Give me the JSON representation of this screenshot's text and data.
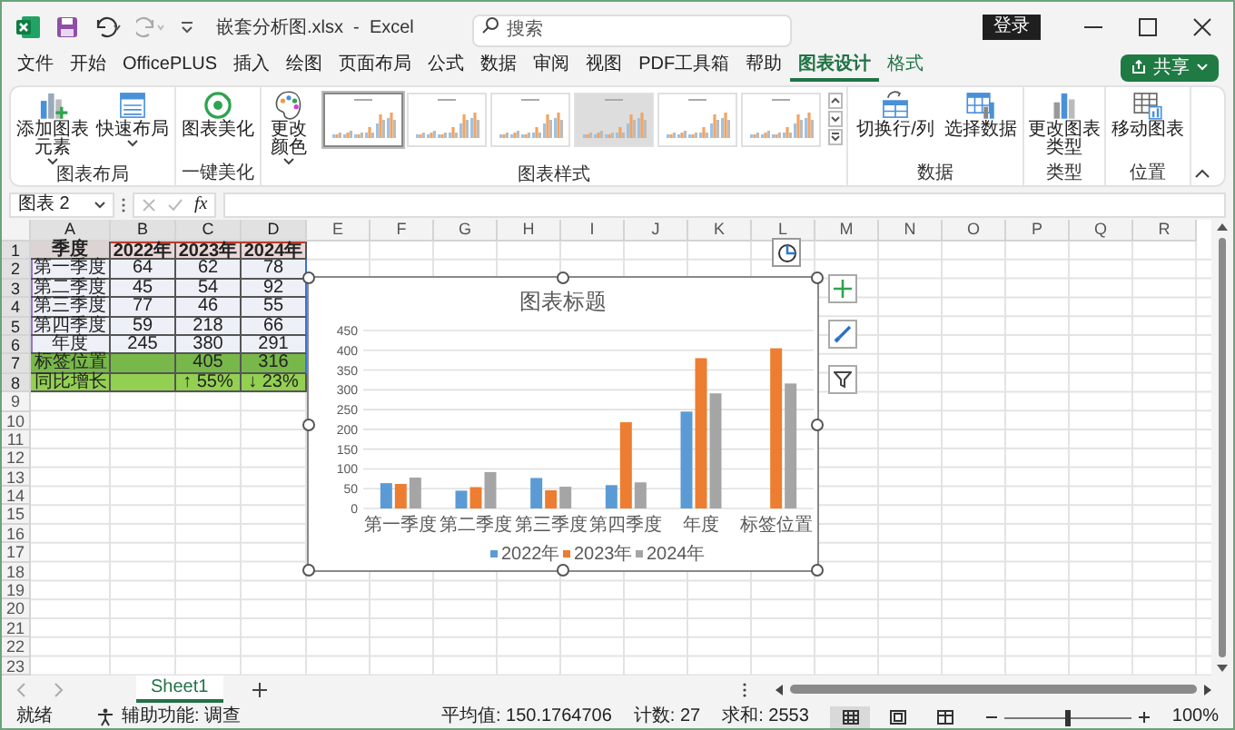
{
  "title_bar": {
    "file_title": "嵌套分析图.xlsx  -  Excel",
    "search": {
      "placeholder": "搜索"
    },
    "sign_in_button": "登录"
  },
  "menu_tabs": [
    {
      "label": "文件",
      "selected": false,
      "contextual": false
    },
    {
      "label": "开始",
      "selected": false,
      "contextual": false
    },
    {
      "label": "OfficePLUS",
      "selected": false,
      "contextual": false
    },
    {
      "label": "插入",
      "selected": false,
      "contextual": false
    },
    {
      "label": "绘图",
      "selected": false,
      "contextual": false
    },
    {
      "label": "页面布局",
      "selected": false,
      "contextual": false
    },
    {
      "label": "公式",
      "selected": false,
      "contextual": false
    },
    {
      "label": "数据",
      "selected": false,
      "contextual": false
    },
    {
      "label": "审阅",
      "selected": false,
      "contextual": false
    },
    {
      "label": "视图",
      "selected": false,
      "contextual": false
    },
    {
      "label": "PDF工具箱",
      "selected": false,
      "contextual": false
    },
    {
      "label": "帮助",
      "selected": false,
      "contextual": false
    },
    {
      "label": "图表设计",
      "selected": true,
      "contextual": true
    },
    {
      "label": "格式",
      "selected": false,
      "contextual": true
    }
  ],
  "share_button": {
    "label": "共享"
  },
  "ribbon": {
    "groups": [
      {
        "label": "图表布局",
        "buttons": [
          {
            "label": "添加图表元素",
            "dropdown": true
          },
          {
            "label": "快速布局",
            "dropdown": true
          }
        ]
      },
      {
        "label": "一键美化",
        "buttons": [
          {
            "label": "图表美化",
            "dropdown": false
          }
        ]
      },
      {
        "label": "图表样式",
        "buttons": [
          {
            "label": "更改颜色",
            "dropdown": true
          }
        ],
        "gallery": [
          {
            "selected": true
          },
          {
            "selected": false
          },
          {
            "selected": false
          },
          {
            "selected": false
          },
          {
            "selected": false
          },
          {
            "selected": false
          }
        ]
      },
      {
        "label": "数据",
        "buttons": [
          {
            "label": "切换行/列",
            "dropdown": false
          },
          {
            "label": "选择数据",
            "dropdown": false
          }
        ]
      },
      {
        "label": "类型",
        "buttons": [
          {
            "label": "更改图表类型",
            "dropdown": false
          }
        ]
      },
      {
        "label": "位置",
        "buttons": [
          {
            "label": "移动图表",
            "dropdown": false
          }
        ]
      }
    ]
  },
  "formula_bar": {
    "name_box": "图表 2",
    "function_label": "fx"
  },
  "sheet": {
    "columns": [
      "A",
      "B",
      "C",
      "D",
      "E",
      "F",
      "G",
      "H",
      "I",
      "J",
      "K",
      "L",
      "M",
      "N",
      "O",
      "P",
      "Q",
      "R"
    ],
    "rows": [
      {
        "number": "1",
        "kind": "header",
        "cells": [
          "季度",
          "2022年",
          "2023年",
          "2024年"
        ]
      },
      {
        "number": "2",
        "kind": "data",
        "cells": [
          "第一季度",
          "64",
          "62",
          "78"
        ]
      },
      {
        "number": "3",
        "kind": "data",
        "cells": [
          "第二季度",
          "45",
          "54",
          "92"
        ]
      },
      {
        "number": "4",
        "kind": "data",
        "cells": [
          "第三季度",
          "77",
          "46",
          "55"
        ]
      },
      {
        "number": "5",
        "kind": "data",
        "cells": [
          "第四季度",
          "59",
          "218",
          "66"
        ]
      },
      {
        "number": "6",
        "kind": "data",
        "cells": [
          "年度",
          "245",
          "380",
          "291"
        ]
      },
      {
        "number": "7",
        "kind": "marker",
        "cells": [
          "标签位置",
          null,
          "405",
          "316"
        ]
      },
      {
        "number": "8",
        "kind": "growth",
        "cells": [
          "同比增长",
          null,
          "↑ 55%",
          "↓ 23%"
        ]
      }
    ],
    "empty_rows": [
      "9",
      "10",
      "11",
      "12",
      "13",
      "14",
      "15",
      "16",
      "17",
      "18",
      "19",
      "20",
      "21",
      "22",
      "23"
    ]
  },
  "chart": {
    "chart_data": {
      "type": "bar",
      "title": "图表标题",
      "categories": [
        "第一季度",
        "第二季度",
        "第三季度",
        "第四季度",
        "年度",
        "标签位置"
      ],
      "series": [
        {
          "name": "2022年",
          "color": "#5b9bd5",
          "values": [
            64,
            45,
            77,
            59,
            245,
            null
          ]
        },
        {
          "name": "2023年",
          "color": "#ed7d31",
          "values": [
            62,
            54,
            46,
            218,
            380,
            405
          ]
        },
        {
          "name": "2024年",
          "color": "#a5a5a5",
          "values": [
            78,
            92,
            55,
            66,
            291,
            316
          ]
        }
      ],
      "grid": true,
      "legend": true,
      "ylim": [
        0,
        450
      ],
      "yticks": [
        0,
        50,
        100,
        150,
        200,
        250,
        300,
        350,
        400,
        450
      ]
    }
  },
  "sheet_tabs": [
    {
      "label": "Sheet1",
      "selected": true
    }
  ],
  "status_bar": {
    "mode": "就绪",
    "accessibility": "辅助功能: 调查",
    "average": "平均值: 150.1764706",
    "count": "计数: 27",
    "sum": "求和: 2553",
    "views": [
      {
        "selected": true
      },
      {
        "selected": false
      },
      {
        "selected": false
      }
    ],
    "zoom": {
      "level": 0.5,
      "label": "100%"
    }
  }
}
